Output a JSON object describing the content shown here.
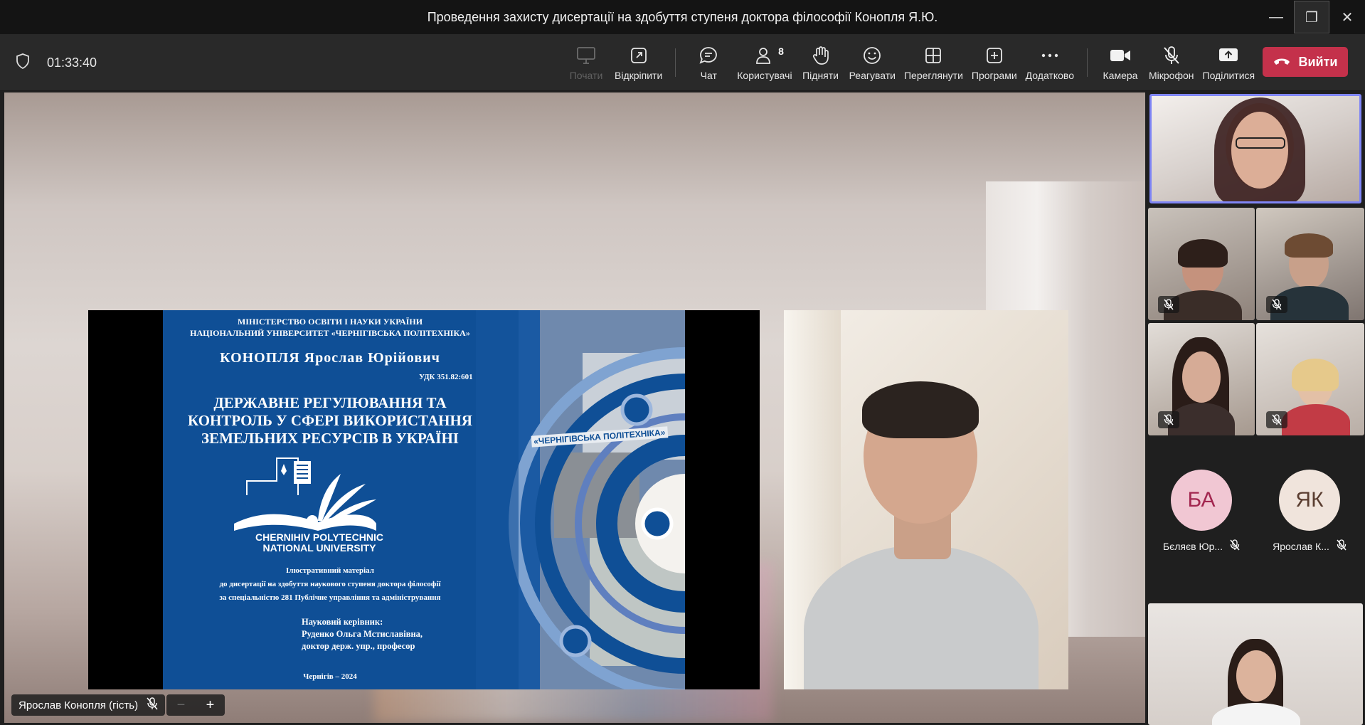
{
  "window": {
    "title": "Проведення захисту дисертації на здобуття ступеня доктора філософії Конопля Я.Ю."
  },
  "toolbar": {
    "timer": "01:33:40",
    "buttons": [
      {
        "label": "Почати",
        "icon": "record-icon",
        "disabled": true
      },
      {
        "label": "Відкріпити",
        "icon": "pop-out-icon"
      },
      {
        "label": "Чат",
        "icon": "chat-icon"
      },
      {
        "label": "Користувачі",
        "icon": "people-icon",
        "count": "8"
      },
      {
        "label": "Підняти",
        "icon": "raise-hand-icon"
      },
      {
        "label": "Реагувати",
        "icon": "react-icon"
      },
      {
        "label": "Переглянути",
        "icon": "view-icon"
      },
      {
        "label": "Програми",
        "icon": "apps-icon"
      },
      {
        "label": "Додатково",
        "icon": "more-icon"
      },
      {
        "label": "Камера",
        "icon": "camera-icon"
      },
      {
        "label": "Мікрофон",
        "icon": "mic-off-icon"
      },
      {
        "label": "Поділитися",
        "icon": "share-icon"
      }
    ],
    "leave_label": "Вийти",
    "accent_leave": "#c4314b"
  },
  "slide": {
    "ministry": "МІНІСТЕРСТВО ОСВІТИ І НАУКИ  УКРАЇНИ",
    "university": "НАЦІОНАЛЬНИЙ УНІВЕРСИТЕТ  «ЧЕРНІГІВСЬКА ПОЛІТЕХНІКА»",
    "author": "КОНОПЛЯ  Ярослав  Юрійович",
    "udk": "УДК 351.82:601",
    "topic_line1": "ДЕРЖАВНЕ РЕГУЛЮВАННЯ ТА",
    "topic_line2": "КОНТРОЛЬ У СФЕРІ ВИКОРИСТАННЯ",
    "topic_line3": "ЗЕМЕЛЬНИХ РЕСУРСІВ В УКРАЇНІ",
    "logo_line1": "CHERNIHIV POLYTECHNIC",
    "logo_line2": "NATIONAL UNIVERSITY",
    "ill_line1": "Ілюстративний матеріал",
    "ill_line2": "до дисертації на здобуття наукового ступеня доктора філософії",
    "ill_line3": "за спеціальністю 281 Публічне управління та адміністрування",
    "sup_title": "Науковий керівник:",
    "sup_name": "Руденко Ольга Мстиславівна,",
    "sup_degree": "доктор держ. упр., професор",
    "city_year": "Чернігів – 2024",
    "building_sign": "«ЧЕРНІГІВСЬКА ПОЛІТЕХНІКА»"
  },
  "stage": {
    "name_chip": "Ярослав Конопля (гість)"
  },
  "gallery": {
    "avatars": [
      {
        "initials": "БА",
        "name": "Бєляєв Юр..."
      },
      {
        "initials": "ЯК",
        "name": "Ярослав К..."
      }
    ]
  }
}
